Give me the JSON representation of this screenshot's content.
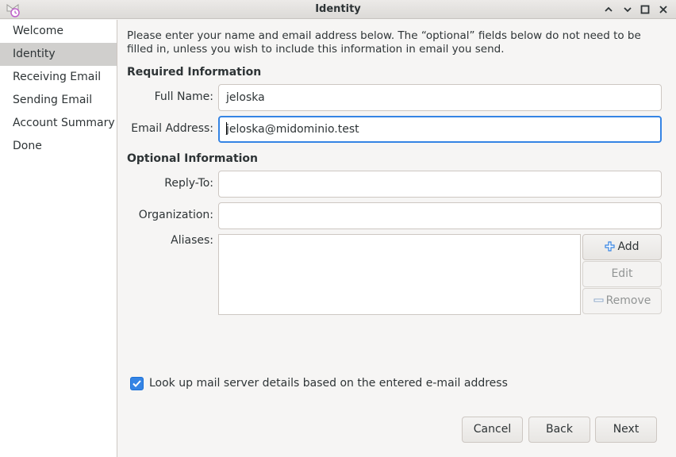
{
  "window": {
    "title": "Identity",
    "controls": {
      "minimize_icon": "chevron-up-icon",
      "restore_icon": "chevron-down-icon",
      "maximize_icon": "square-icon",
      "close_icon": "close-icon"
    }
  },
  "sidebar": {
    "items": [
      {
        "label": "Welcome",
        "active": false
      },
      {
        "label": "Identity",
        "active": true
      },
      {
        "label": "Receiving Email",
        "active": false
      },
      {
        "label": "Sending Email",
        "active": false
      },
      {
        "label": "Account Summary",
        "active": false
      },
      {
        "label": "Done",
        "active": false
      }
    ]
  },
  "main": {
    "intro": "Please enter your name and email address below. The “optional” fields below do not need to be filled in, unless you wish to include this information in email you send.",
    "required_title": "Required Information",
    "full_name": {
      "label": "Full Name:",
      "value": "jeloska"
    },
    "email": {
      "label": "Email Address:",
      "value": "jeloska@midominio.test"
    },
    "optional_title": "Optional Information",
    "reply_to": {
      "label": "Reply-To:",
      "value": ""
    },
    "organization": {
      "label": "Organization:",
      "value": ""
    },
    "aliases": {
      "label": "Aliases:"
    },
    "buttons": {
      "add": "Add",
      "edit": "Edit",
      "remove": "Remove"
    },
    "lookup": {
      "label": "Look up mail server details based on the entered e-mail address",
      "checked": true
    },
    "nav": {
      "cancel": "Cancel",
      "back": "Back",
      "next": "Next"
    }
  },
  "colors": {
    "accent": "#3584e4",
    "sidebar_active": "#d0cfcd",
    "background": "#f6f5f4"
  }
}
